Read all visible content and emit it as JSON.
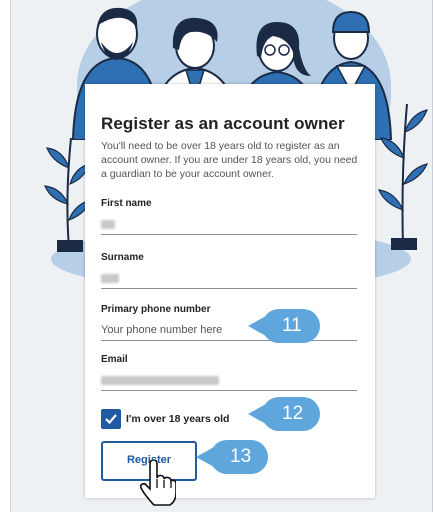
{
  "form": {
    "title": "Register as an account owner",
    "intro": "You'll need to be over 18 years old to register as an account owner. If you are under 18 years old, you need a guardian to be your account owner.",
    "first_name": {
      "label": "First name",
      "value": ""
    },
    "surname": {
      "label": "Surname",
      "value": ""
    },
    "phone": {
      "label": "Primary phone number",
      "placeholder": "Your phone number here"
    },
    "email": {
      "label": "Email",
      "value": ""
    },
    "age_checkbox": {
      "label": "I'm over 18 years old",
      "checked": true
    },
    "register_label": "Register"
  },
  "callouts": {
    "phone": "11",
    "checkbox": "12",
    "register": "13"
  },
  "colors": {
    "accent": "#1f5aa3",
    "callout": "#5ea6dc",
    "backdrop": "#b6cfe6"
  },
  "icons": [
    "checkmark-icon",
    "hand-pointer-cursor-icon",
    "plant-icon",
    "person-illustration"
  ]
}
